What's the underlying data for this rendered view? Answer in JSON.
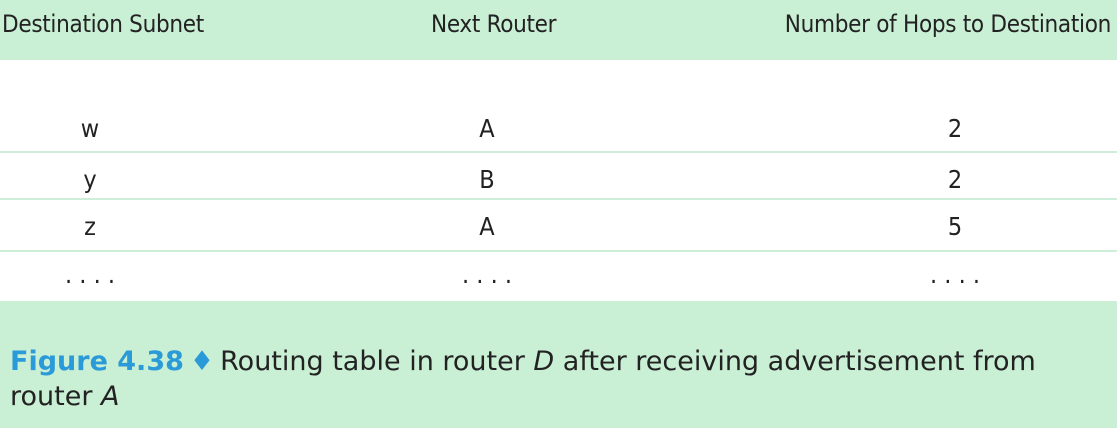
{
  "table": {
    "headers": {
      "destination": "Destination Subnet",
      "next_router": "Next Router",
      "hops": "Number of Hops to Destination"
    },
    "rows": [
      {
        "destination": "w",
        "next_router": "A",
        "hops": "2"
      },
      {
        "destination": "y",
        "next_router": "B",
        "hops": "2"
      },
      {
        "destination": "z",
        "next_router": "A",
        "hops": "5"
      },
      {
        "destination": ". . . .",
        "next_router": ". . . .",
        "hops": ". . . ."
      }
    ]
  },
  "caption": {
    "label": "Figure 4.38",
    "symbol": "♦",
    "text_part1": "Routing table in router ",
    "router1": "D",
    "text_part2": " after receiving advertisement from router ",
    "router2": "A"
  },
  "colors": {
    "band": "#c9efd4",
    "rule": "#cfeeda",
    "figure_label": "#2a9ad8"
  }
}
